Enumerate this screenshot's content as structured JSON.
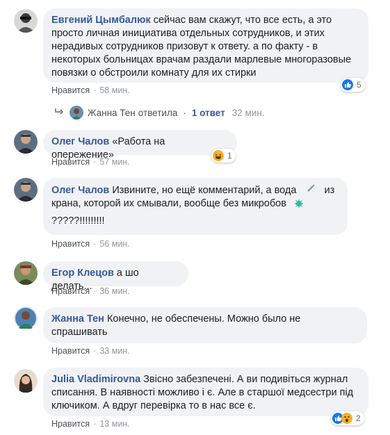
{
  "comments": [
    {
      "author": "Евгений Цымбалюк",
      "text": "сейчас вам скажут, что все есть, а это просто личная инициатива отдельных сотрудников, и этих нерадивых сотрудников призовут к ответу. а по факту - в некоторых больницах врачам раздали марлевые многоразовые повязки о обстроили комнату для их стирки",
      "lines": [
        "сейчас вам скажут, что все есть, а это",
        "просто личная инициатива отдельных сотрудников, и этих",
        "нерадивых сотрудников призовут к ответу. а по факту - в",
        "некоторых больницах врачам раздали марлевые многоразовые",
        "повязки о обстроили комнату для их стирки"
      ],
      "like": "Нравится",
      "time": "58 мин.",
      "reactions": "5",
      "reaction_icons": [
        "like-icon"
      ]
    },
    {
      "author": "Олег Чалов",
      "text": "«Работа на опережение»",
      "like": "Нравится",
      "time": "57 мин.",
      "reactions": "1",
      "reaction_icons": [
        "haha-icon"
      ]
    },
    {
      "author": "Олег Чалов",
      "lines": [
        "Извините, но ещё комментарий, а вода",
        "из",
        "крана, которой их смывали, вообще без микробов",
        "?????!!!!!!!!!"
      ],
      "like": "Нравится",
      "time": "56 мин."
    },
    {
      "author": "Егор Клецов",
      "text": "а шо делать...",
      "like": "Нравится",
      "time": "36 мин."
    },
    {
      "author": "Жанна Тен",
      "lines": [
        "Конечно, не обеспечены. Можно было не",
        "спрашивать"
      ],
      "like": "Нравится",
      "time": "33 мин."
    },
    {
      "author": "Julia Vladimirovna",
      "lines": [
        "Звісно забезпечені. А ви подивіться журнал",
        "списання. В наявності можливо і є. Але в старшої медсестри під",
        "ключиком. А вдруг перевірка то в нас все є."
      ],
      "like": "Нравится",
      "time": "13 мин.",
      "reactions": "2",
      "reaction_icons": [
        "like-icon",
        "wow-icon"
      ]
    }
  ],
  "reply_thread": {
    "author": "Жанна Тен",
    "action": "ответила",
    "link": "1 ответ",
    "time": "32 мин."
  },
  "separator": "·",
  "colors": {
    "author": "#385898",
    "bubble": "#f0f2f5",
    "meta": "#90949c",
    "like_blue": "#1877f2",
    "haha_yellow": "#f7b125"
  }
}
